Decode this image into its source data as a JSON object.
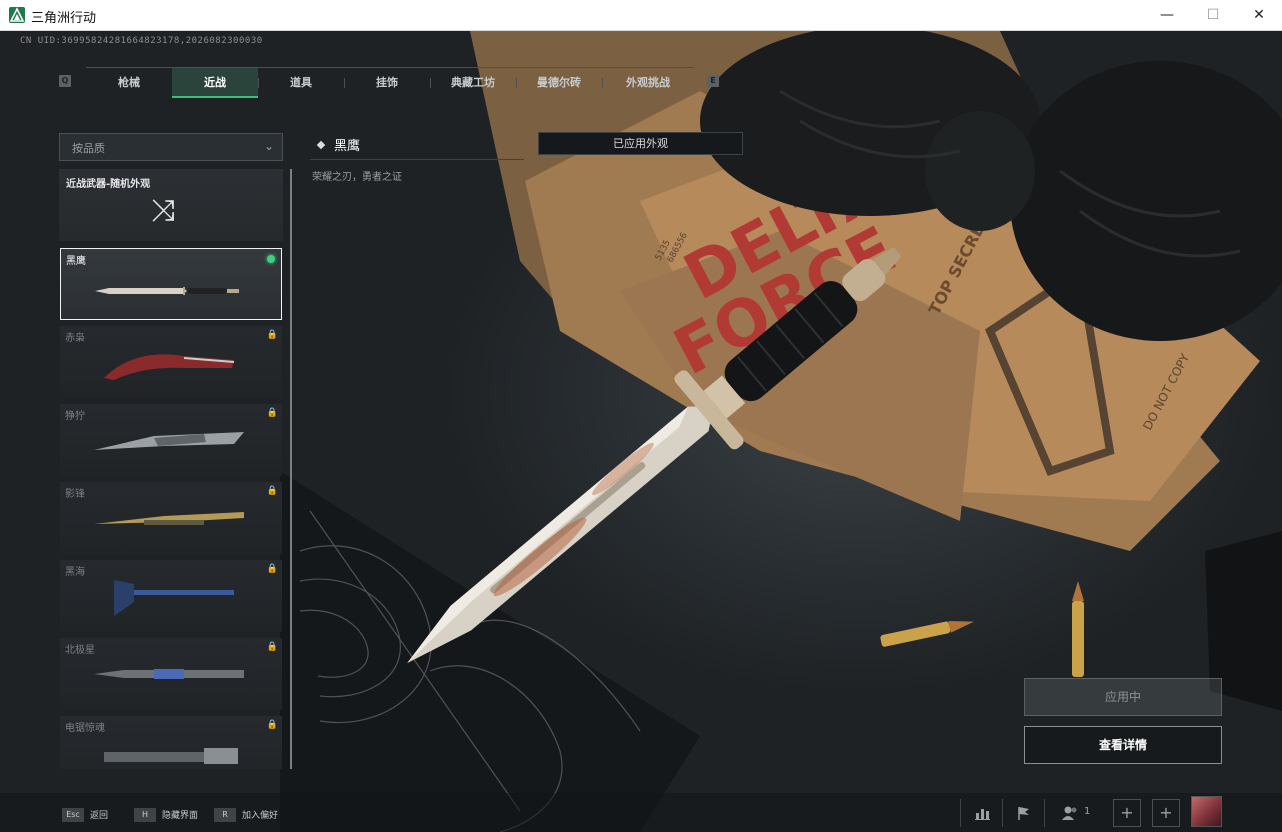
{
  "window": {
    "title": "三角洲行动",
    "minimize_glyph": "—",
    "maximize_glyph": "☐",
    "close_glyph": "✕"
  },
  "uid_text": "CN UID:36995824281664823178,2026082300030",
  "tabs": {
    "left_key": "Q",
    "right_key": "E",
    "items": [
      {
        "label": "枪械",
        "active": false
      },
      {
        "label": "近战",
        "active": true
      },
      {
        "label": "道具",
        "active": false
      },
      {
        "label": "挂饰",
        "active": false
      },
      {
        "label": "典藏工坊",
        "active": false
      },
      {
        "label": "曼德尔砖",
        "active": false
      },
      {
        "label": "外观挑战",
        "active": false
      }
    ]
  },
  "filter": {
    "label": "按品质",
    "icon": "chevron-down-icon"
  },
  "list": {
    "random_card": {
      "label": "近战武器-随机外观",
      "icon": "shuffle-icon"
    },
    "items": [
      {
        "name": "黑鹰",
        "selected": true,
        "equipped": true,
        "locked": false,
        "accent": "#b9a78c"
      },
      {
        "name": "赤枭",
        "selected": false,
        "equipped": false,
        "locked": true,
        "accent": "#8a2a2a"
      },
      {
        "name": "狰狞",
        "selected": false,
        "equipped": false,
        "locked": true,
        "accent": "#9aa0a4"
      },
      {
        "name": "影锋",
        "selected": false,
        "equipped": false,
        "locked": true,
        "accent": "#b59a55"
      },
      {
        "name": "黑海",
        "selected": false,
        "equipped": false,
        "locked": true,
        "accent": "#3a5a9a"
      },
      {
        "name": "北极星",
        "selected": false,
        "equipped": false,
        "locked": true,
        "accent": "#4a6ab8"
      },
      {
        "name": "电锯惊魂",
        "selected": false,
        "equipped": false,
        "locked": true,
        "accent": "#8a8f93"
      }
    ]
  },
  "detail": {
    "name": "黑鹰",
    "description": "荣耀之刃，勇者之证",
    "applied_tag": "已应用外观"
  },
  "actions": {
    "applying_label": "应用中",
    "detail_label": "查看详情"
  },
  "bottom": {
    "hints": [
      {
        "key": "Esc",
        "text": "返回"
      },
      {
        "key": "H",
        "text": "隐藏界面"
      },
      {
        "key": "R",
        "text": "加入偏好"
      }
    ],
    "squad_count": "1",
    "plus_glyph": "+",
    "icons": [
      "stats-icon",
      "flag-icon",
      "squad-icon",
      "avatar"
    ]
  },
  "scene": {
    "folder_text_1": "DELTA",
    "folder_text_2": "FORCE",
    "stamp_text": "TOP SECRET",
    "folder_code_1": "5135",
    "folder_code_2": "686556",
    "side_text": "DO NOT COPY",
    "colors": {
      "folder": "#b78a5c",
      "folder_red": "#b23a34",
      "table": "#2d3236",
      "glove": "#1a1c1d",
      "blade": "#d8d2c6",
      "rust": "#b55e3a",
      "bullet": "#c9a24a"
    }
  }
}
